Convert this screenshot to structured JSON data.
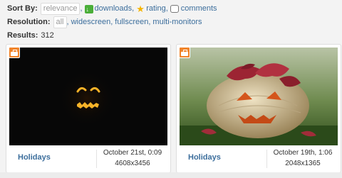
{
  "filters": {
    "sort_label": "Sort By:",
    "sort_options": [
      "relevance",
      "downloads",
      "rating",
      "comments"
    ],
    "resolution_label": "Resolution:",
    "resolution_options": [
      "all",
      "widescreen",
      "fullscreen",
      "multi-monitors"
    ],
    "results_label": "Results:",
    "results_count": "312"
  },
  "cards": [
    {
      "category": "Holidays",
      "date": "October 21st, 0:09",
      "dimensions": "4608x3456",
      "badge_icon": "briefcase-icon"
    },
    {
      "category": "Holidays",
      "date": "October 19th, 1:06",
      "dimensions": "2048x1365",
      "badge_icon": "briefcase-icon"
    }
  ],
  "colors": {
    "link": "#3c6e9c",
    "badge": "#f0842a",
    "download_icon": "#4aae38",
    "star_icon": "#f5b400"
  }
}
